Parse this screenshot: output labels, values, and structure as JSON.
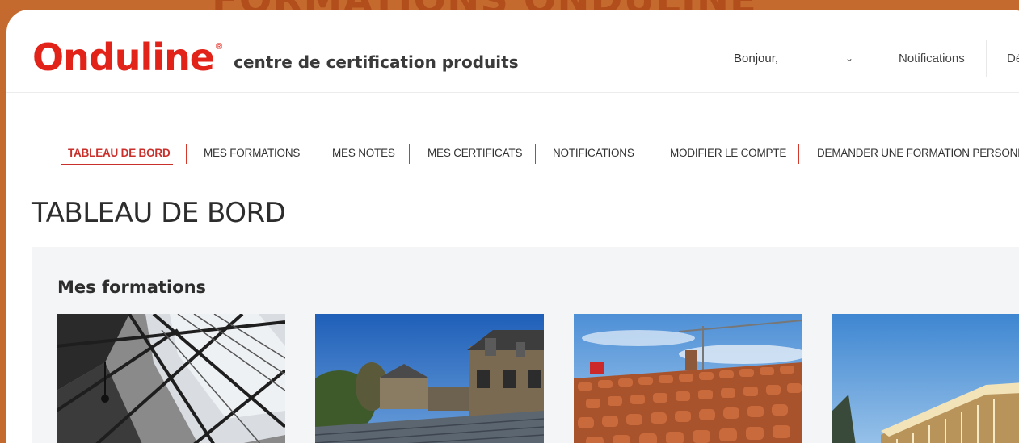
{
  "banner": {
    "text": "FORMATIONS ONDULINE"
  },
  "header": {
    "logo_text": "Onduline",
    "logo_reg": "®",
    "subtitle": "centre de certification produits",
    "greeting": "Bonjour,",
    "chevron": "⌄",
    "notifications": "Notifications",
    "logout_partial": "Dé"
  },
  "nav": {
    "items": [
      {
        "label": "TABLEAU DE BORD"
      },
      {
        "label": "MES FORMATIONS"
      },
      {
        "label": "MES NOTES"
      },
      {
        "label": "MES CERTIFICATS"
      },
      {
        "label": "NOTIFICATIONS"
      },
      {
        "label": "MODIFIER LE COMPTE"
      },
      {
        "label": "DEMANDER UNE FORMATION PERSONNALISÉE"
      }
    ]
  },
  "page": {
    "title": "TABLEAU DE BORD"
  },
  "formations": {
    "title": "Mes formations",
    "cards": [
      {
        "image": "warehouse-roof-image"
      },
      {
        "image": "house-roof-image"
      },
      {
        "image": "tile-roof-image"
      },
      {
        "image": "modern-building-image"
      }
    ]
  },
  "colors": {
    "brand": "#e2231a",
    "accent": "#c9302c",
    "panel": "#f4f5f7",
    "frame": "#c46a2f"
  }
}
